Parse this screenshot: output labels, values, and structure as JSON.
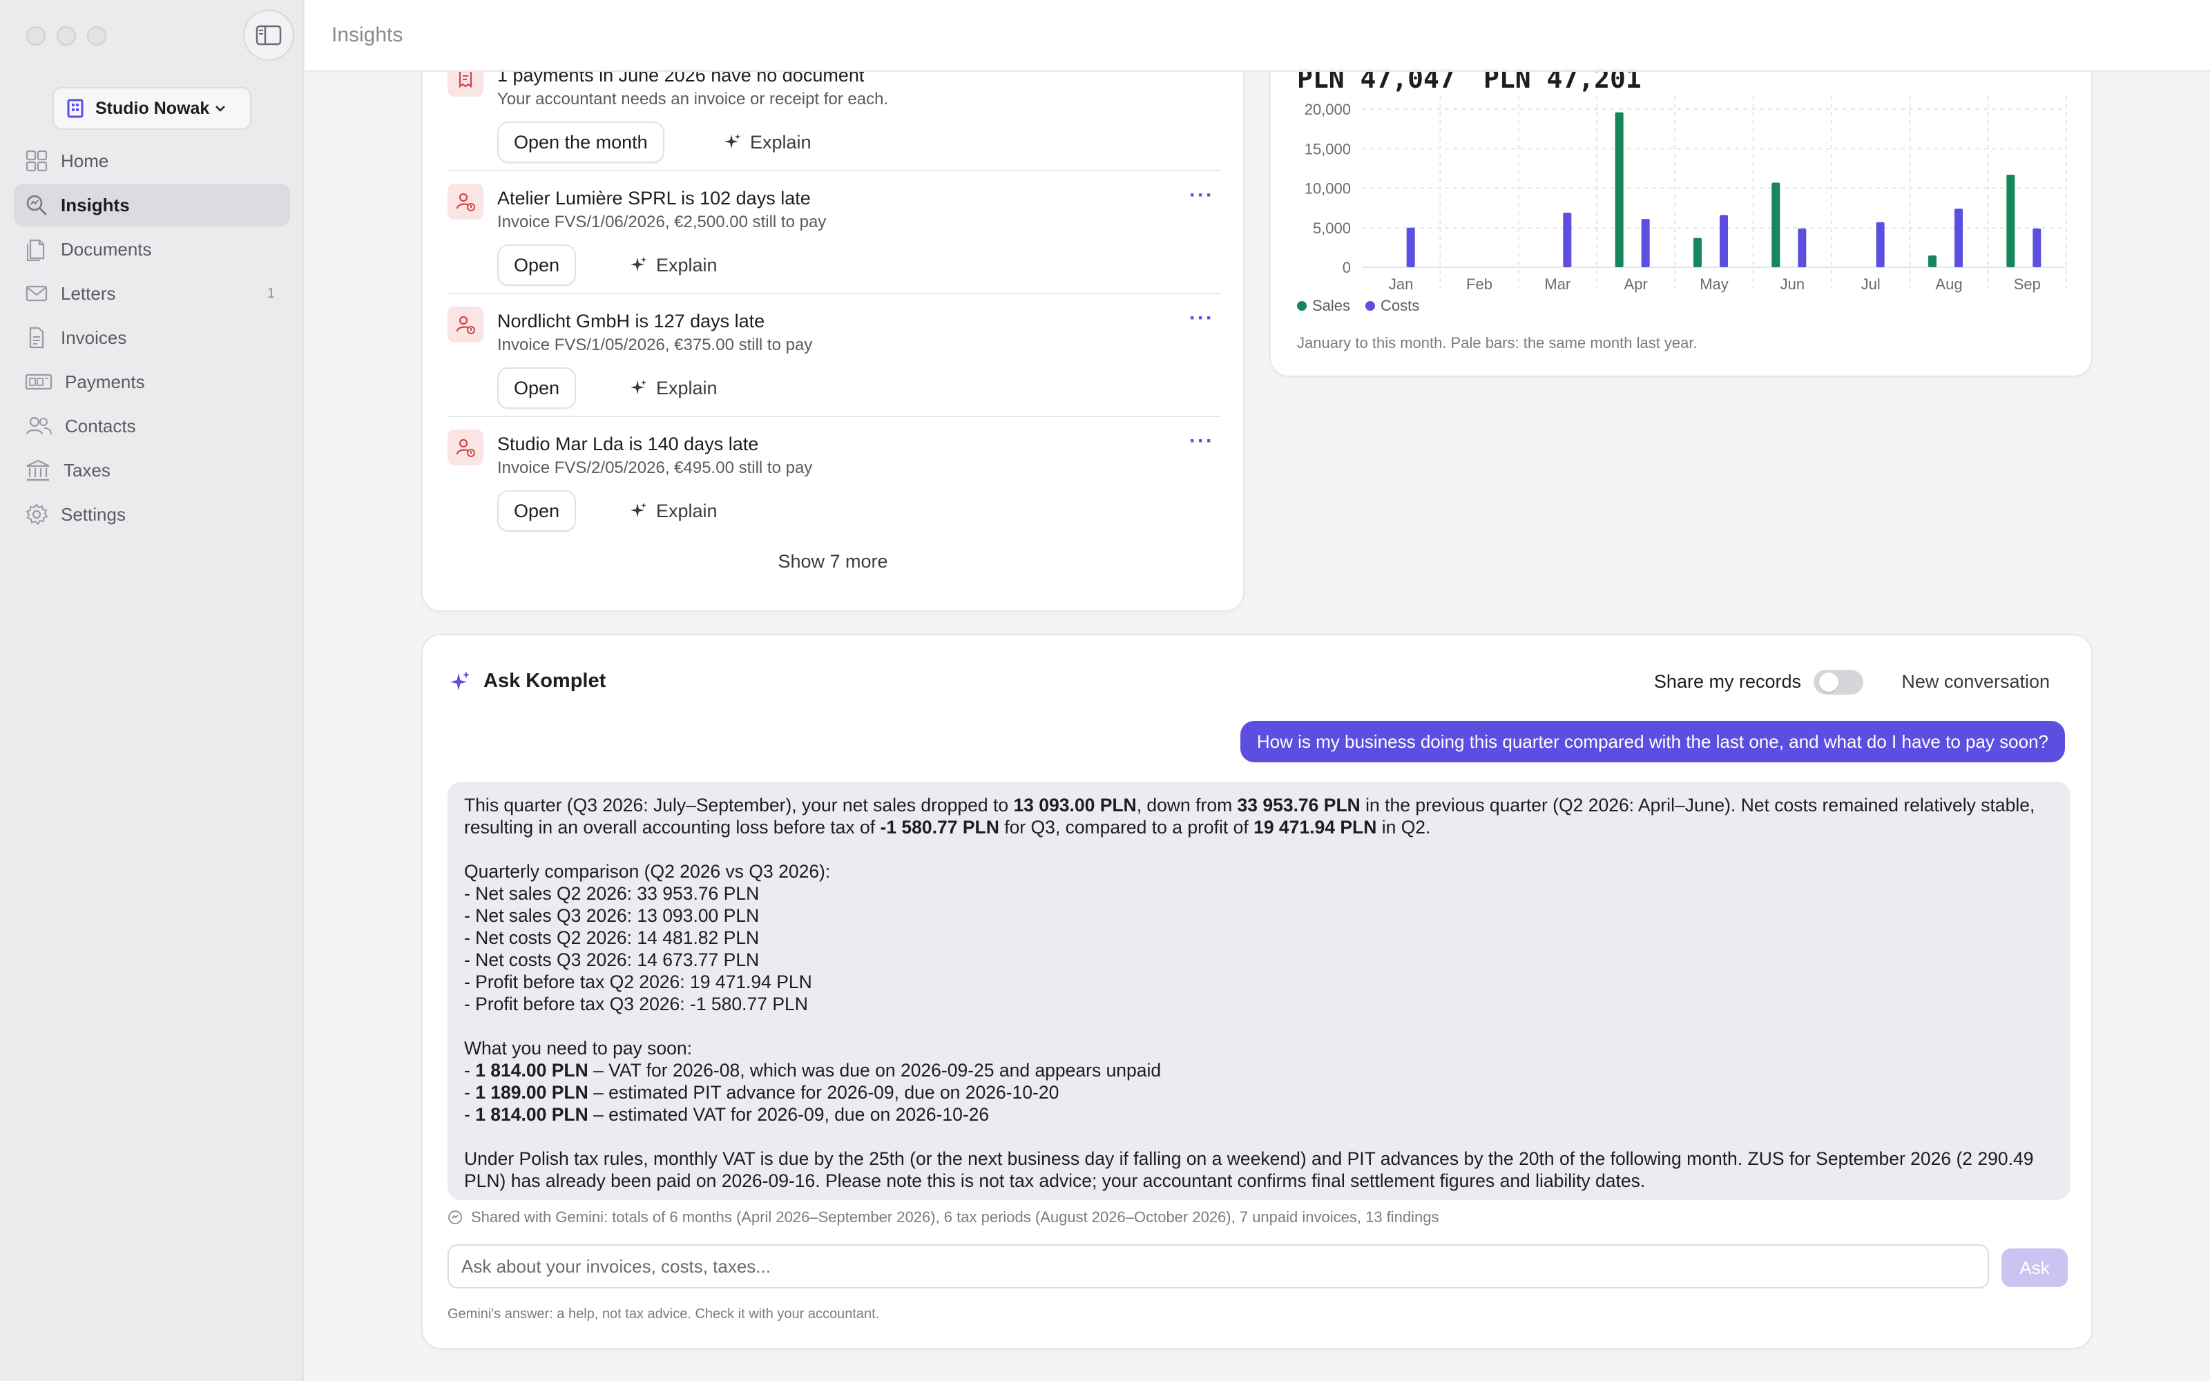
{
  "app": {
    "page_title": "Insights",
    "workspace": "Studio Nowak"
  },
  "sidebar": {
    "items": [
      {
        "label": "Home",
        "icon": "home-icon",
        "badge": ""
      },
      {
        "label": "Insights",
        "icon": "search-icon",
        "badge": "",
        "active": true
      },
      {
        "label": "Documents",
        "icon": "document-icon",
        "badge": ""
      },
      {
        "label": "Letters",
        "icon": "envelope-icon",
        "badge": "1"
      },
      {
        "label": "Invoices",
        "icon": "invoice-icon",
        "badge": ""
      },
      {
        "label": "Payments",
        "icon": "payment-icon",
        "badge": ""
      },
      {
        "label": "Contacts",
        "icon": "contacts-icon",
        "badge": ""
      },
      {
        "label": "Taxes",
        "icon": "bank-icon",
        "badge": ""
      },
      {
        "label": "Settings",
        "icon": "gear-icon",
        "badge": ""
      }
    ]
  },
  "findings": {
    "items": [
      {
        "title": "1 payments in June 2026 have no document",
        "subtitle": "Your accountant needs an invoice or receipt for each.",
        "action": "Open the month",
        "explain": "Explain"
      },
      {
        "title": "Atelier Lumière SPRL is 102 days late",
        "subtitle": "Invoice FVS/1/06/2026, €2,500.00 still to pay",
        "action": "Open",
        "explain": "Explain"
      },
      {
        "title": "Nordlicht GmbH is 127 days late",
        "subtitle": "Invoice FVS/1/05/2026, €375.00 still to pay",
        "action": "Open",
        "explain": "Explain"
      },
      {
        "title": "Studio Mar Lda is 140 days late",
        "subtitle": "Invoice FVS/2/05/2026, €495.00 still to pay",
        "action": "Open",
        "explain": "Explain"
      }
    ],
    "more_label": "···",
    "show_more": "Show 7 more"
  },
  "summary": {
    "sales_value": "PLN 47,047",
    "costs_value": "PLN 47,201",
    "note": "January to this month. Pale bars: the same month last year."
  },
  "colors": {
    "sales": "#16875a",
    "costs": "#5b4ee0",
    "accent": "#5b4ee0"
  },
  "chart_data": {
    "type": "bar",
    "categories": [
      "Jan",
      "Feb",
      "Mar",
      "Apr",
      "May",
      "Jun",
      "Jul",
      "Aug",
      "Sep"
    ],
    "series": [
      {
        "name": "Sales",
        "values": [
          0,
          0,
          0,
          19600,
          3700,
          10700,
          0,
          1500,
          11700
        ]
      },
      {
        "name": "Costs",
        "values": [
          5000,
          0,
          6900,
          6100,
          6600,
          4900,
          5700,
          7400,
          4900
        ]
      }
    ],
    "yticks": [
      "20,000",
      "15,000",
      "10,000",
      "5,000",
      "0"
    ],
    "ylim": [
      0,
      20000
    ],
    "legend": "bottom-left"
  },
  "ask": {
    "title": "Ask Komplet",
    "share_label": "Share my records",
    "new_conversation": "New conversation",
    "user_message": "How is my business doing this quarter compared with the last one, and what do I have to pay soon?",
    "answer": {
      "intro_1": "This quarter (Q3 2026: July–September), your net sales dropped to ",
      "intro_b1": "13 093.00 PLN",
      "intro_2": ", down from ",
      "intro_b2": "33 953.76 PLN",
      "intro_3": " in the previous quarter (Q2 2026: April–June). Net costs remained relatively stable, resulting in an overall accounting loss before tax of ",
      "intro_b3": "-1 580.77 PLN",
      "intro_4": " for Q3, compared to a profit of ",
      "intro_b4": "19 471.94 PLN",
      "intro_5": " in Q2.",
      "comparison_heading": "Quarterly comparison (Q2 2026 vs Q3 2026):",
      "comparison": [
        "- Net sales Q2 2026: 33 953.76 PLN",
        "- Net sales Q3 2026: 13 093.00 PLN",
        "- Net costs Q2 2026: 14 481.82 PLN",
        "- Net costs Q3 2026: 14 673.77 PLN",
        "- Profit before tax Q2 2026: 19 471.94 PLN",
        "- Profit before tax Q3 2026: -1 580.77 PLN"
      ],
      "pay_heading": "What you need to pay soon:",
      "pay": [
        {
          "amount": "1 814.00 PLN",
          "text": " – VAT for 2026-08, which was due on 2026-09-25 and appears unpaid"
        },
        {
          "amount": "1 189.00 PLN",
          "text": " – estimated PIT advance for 2026-09, due on 2026-10-20"
        },
        {
          "amount": "1 814.00 PLN",
          "text": " – estimated VAT for 2026-09, due on 2026-10-26"
        }
      ],
      "footer": "Under Polish tax rules, monthly VAT is due by the 25th (or the next business day if falling on a weekend) and PIT advances by the 20th of the following month. ZUS for September 2026 (2 290.49 PLN) has already been paid on 2026-09-16. Please note this is not tax advice; your accountant confirms final settlement figures and liability dates."
    },
    "shared_note": "Shared with Gemini: totals of 6 months (April 2026–September 2026), 6 tax periods (August 2026–October 2026), 7 unpaid invoices, 13 findings",
    "input_placeholder": "Ask about your invoices, costs, taxes...",
    "ask_button": "Ask",
    "disclaimer": "Gemini's answer: a help, not tax advice. Check it with your accountant."
  }
}
